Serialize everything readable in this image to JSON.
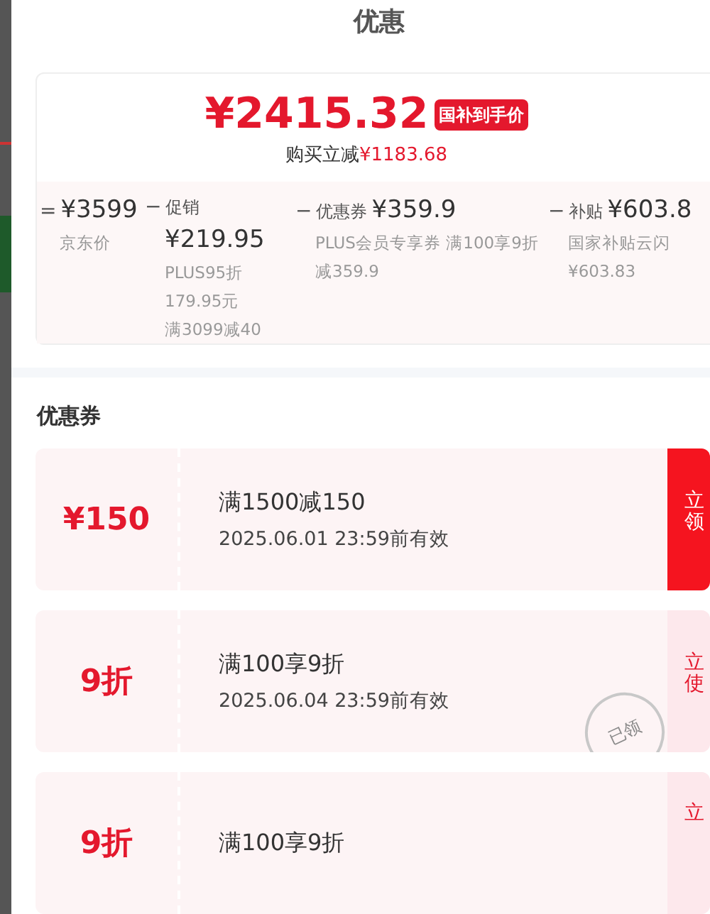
{
  "title": "优惠",
  "summary": {
    "price": "¥2415.32",
    "badge": "国补到手价",
    "saving_label": "购买立减",
    "saving": "¥1183.68"
  },
  "breakdown": [
    {
      "op": "=",
      "value": "¥3599",
      "notes": [
        "京东价"
      ]
    },
    {
      "op": "−",
      "label": "促销",
      "value": "¥219.95",
      "notes": [
        "PLUS95折",
        "179.95元",
        "满3099减40"
      ]
    },
    {
      "op": "−",
      "label": "优惠券",
      "value": "¥359.9",
      "notes": [
        "PLUS会员专享券 满100享9折减359.9"
      ]
    },
    {
      "op": "−",
      "label": "补贴",
      "value": "¥603.8",
      "notes": [
        "国家补贴云闪",
        "¥603.83"
      ]
    }
  ],
  "coupons_title": "优惠券",
  "coupons": [
    {
      "amount": "¥150",
      "title": "满1500减150",
      "validity": "2025.06.01 23:59前有效",
      "action": "立领",
      "claimed": false
    },
    {
      "amount": "9折",
      "title": "满100享9折",
      "validity": "2025.06.04 23:59前有效",
      "action": "立使",
      "claimed": true,
      "stamp": "已领"
    },
    {
      "amount": "9折",
      "title": "满100享9折",
      "action": "立",
      "claimed": true
    }
  ]
}
